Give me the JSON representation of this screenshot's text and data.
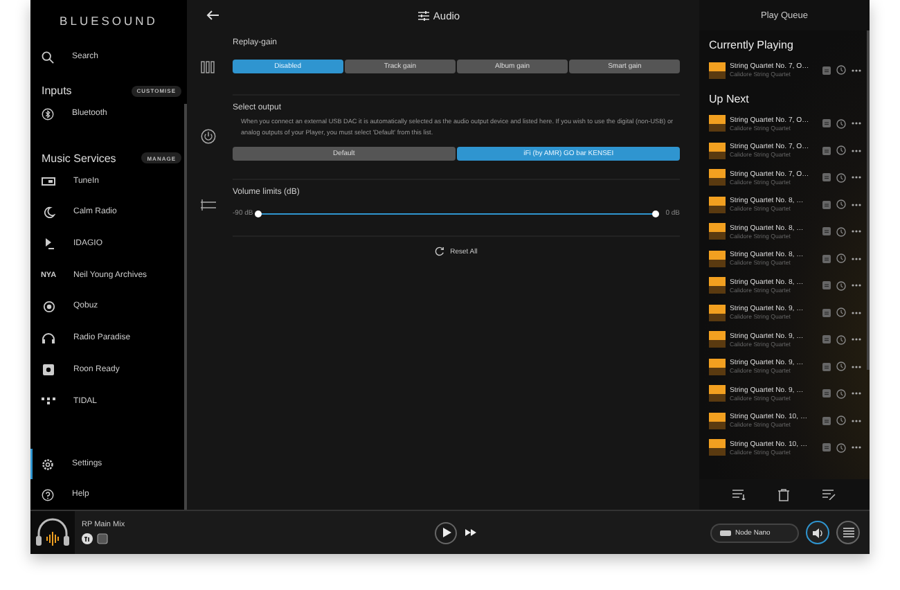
{
  "sidebar": {
    "logo": "BLUESOUND",
    "search": {
      "label": "Search"
    },
    "inputs": {
      "title": "Inputs",
      "action": "CUSTOMISE",
      "items": [
        {
          "label": "Bluetooth"
        }
      ]
    },
    "services": {
      "title": "Music Services",
      "action": "MANAGE",
      "items": [
        {
          "label": "TuneIn"
        },
        {
          "label": "Calm Radio"
        },
        {
          "label": "IDAGIO"
        },
        {
          "label": "Neil Young Archives",
          "icon_text": "NYA"
        },
        {
          "label": "Qobuz"
        },
        {
          "label": "Radio Paradise"
        },
        {
          "label": "Roon Ready"
        },
        {
          "label": "TIDAL"
        }
      ]
    },
    "bottom": [
      {
        "label": "Settings",
        "selected": true
      },
      {
        "label": "Help",
        "selected": false
      }
    ]
  },
  "main": {
    "title": "Audio",
    "replay_gain": {
      "label": "Replay-gain",
      "options": [
        {
          "label": "Disabled",
          "selected": true
        },
        {
          "label": "Track gain",
          "selected": false
        },
        {
          "label": "Album gain",
          "selected": false
        },
        {
          "label": "Smart gain",
          "selected": false
        }
      ]
    },
    "output": {
      "label": "Select output",
      "description": "When you connect an external USB DAC it is automatically selected as the audio output device and listed here. If you wish to use the digital (non-USB) or analog outputs of your Player, you must select 'Default' from this list.",
      "options": [
        {
          "label": "Default",
          "selected": false
        },
        {
          "label": "iFi (by AMR) GO bar KENSEI",
          "selected": true
        }
      ]
    },
    "volume": {
      "label": "Volume limits (dB)",
      "min_label": "-90 dB",
      "max_label": "0 dB",
      "level": 1
    },
    "reset": "Reset All"
  },
  "queue": {
    "title": "Play Queue",
    "current_title": "Currently Playing",
    "current": {
      "title": "String Quartet No. 7, O…",
      "artist": "Calidore String Quartet"
    },
    "next_title": "Up Next",
    "items": [
      {
        "title": "String Quartet No. 7, O…",
        "artist": "Calidore String Quartet"
      },
      {
        "title": "String Quartet No. 7, O…",
        "artist": "Calidore String Quartet"
      },
      {
        "title": "String Quartet No. 7, O…",
        "artist": "Calidore String Quartet"
      },
      {
        "title": "String Quartet No. 8, …",
        "artist": "Calidore String Quartet"
      },
      {
        "title": "String Quartet No. 8, …",
        "artist": "Calidore String Quartet"
      },
      {
        "title": "String Quartet No. 8, …",
        "artist": "Calidore String Quartet"
      },
      {
        "title": "String Quartet No. 8, …",
        "artist": "Calidore String Quartet"
      },
      {
        "title": "String Quartet No. 9, …",
        "artist": "Calidore String Quartet"
      },
      {
        "title": "String Quartet No. 9, …",
        "artist": "Calidore String Quartet"
      },
      {
        "title": "String Quartet No. 9, …",
        "artist": "Calidore String Quartet"
      },
      {
        "title": "String Quartet No. 9, …",
        "artist": "Calidore String Quartet"
      },
      {
        "title": "String Quartet No. 10, …",
        "artist": "Calidore String Quartet"
      },
      {
        "title": "String Quartet No. 10, …",
        "artist": "Calidore String Quartet"
      }
    ]
  },
  "player": {
    "station": "RP Main Mix",
    "device": "Node Nano"
  }
}
